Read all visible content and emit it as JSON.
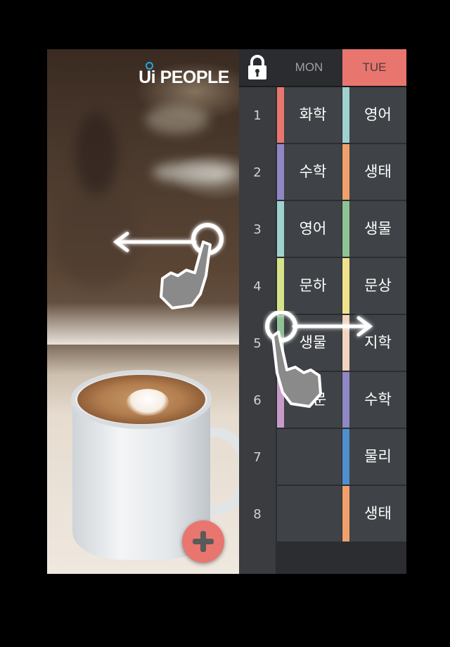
{
  "brand": {
    "logo_text": "Ui PEOPLE"
  },
  "colors": {
    "accent": "#e8766f",
    "table_bg": "#2b2d30",
    "cell_bg": "#3f4246"
  },
  "add_button": {
    "icon": "plus-icon"
  },
  "lock": {
    "icon": "lock-icon"
  },
  "days": [
    {
      "label": "MON",
      "selected": false
    },
    {
      "label": "TUE",
      "selected": true
    }
  ],
  "periods": [
    "1",
    "2",
    "3",
    "4",
    "5",
    "6",
    "7",
    "8"
  ],
  "schedule": {
    "mon": [
      {
        "subject": "화학",
        "color": "#e8766f"
      },
      {
        "subject": "수학",
        "color": "#8f88c4"
      },
      {
        "subject": "영어",
        "color": "#9fd1cf"
      },
      {
        "subject": "문하",
        "color": "#d6e38a"
      },
      {
        "subject": "생물",
        "color": "#8fc396"
      },
      {
        "subject": "한문",
        "color": "#c79ac9"
      },
      {
        "subject": "",
        "color": ""
      },
      {
        "subject": "",
        "color": ""
      }
    ],
    "tue": [
      {
        "subject": "영어",
        "color": "#9fd1cf"
      },
      {
        "subject": "생태",
        "color": "#f0a06a"
      },
      {
        "subject": "생물",
        "color": "#8fc396"
      },
      {
        "subject": "문상",
        "color": "#f0e28a"
      },
      {
        "subject": "지학",
        "color": "#f2d3c0"
      },
      {
        "subject": "수학",
        "color": "#8f88c4"
      },
      {
        "subject": "물리",
        "color": "#4f8fce"
      },
      {
        "subject": "생태",
        "color": "#f0a06a"
      }
    ]
  },
  "gestures": [
    {
      "icon": "swipe-left-hand-icon"
    },
    {
      "icon": "swipe-right-hand-icon"
    }
  ]
}
